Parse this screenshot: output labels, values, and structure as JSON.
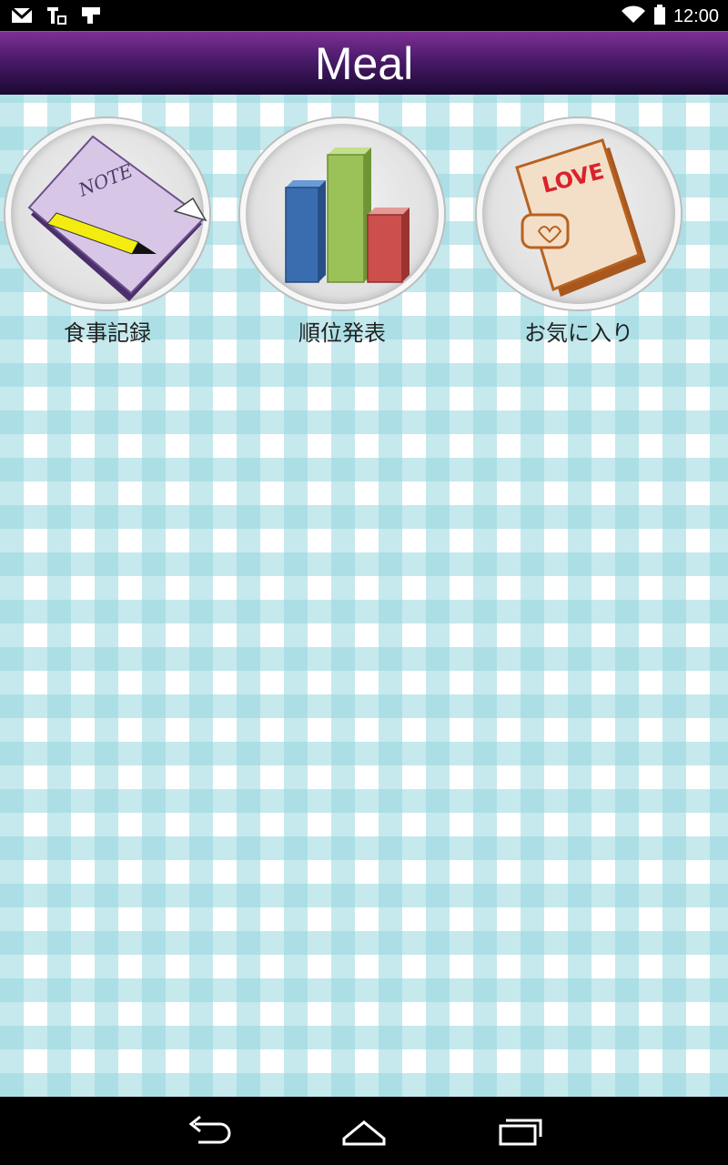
{
  "status_bar": {
    "time": "12:00",
    "left_icons": [
      "gmail-icon",
      "ticket-icon",
      "download-icon"
    ],
    "right_icons": [
      "wifi-icon",
      "battery-icon"
    ]
  },
  "action_bar": {
    "title": "Meal",
    "gradient_top": "#7d2f95",
    "gradient_bottom": "#1a0830"
  },
  "tiles": [
    {
      "label": "食事記録",
      "icon": "note-icon"
    },
    {
      "label": "順位発表",
      "icon": "bar-chart-icon"
    },
    {
      "label": "お気に入り",
      "icon": "love-book-icon"
    }
  ],
  "note_icon_text": "NOTE",
  "love_icon_text": "LOVE",
  "navigation": {
    "buttons": [
      "back-icon",
      "home-icon",
      "recents-icon"
    ]
  },
  "colors": {
    "gingham": "#96d7de"
  }
}
